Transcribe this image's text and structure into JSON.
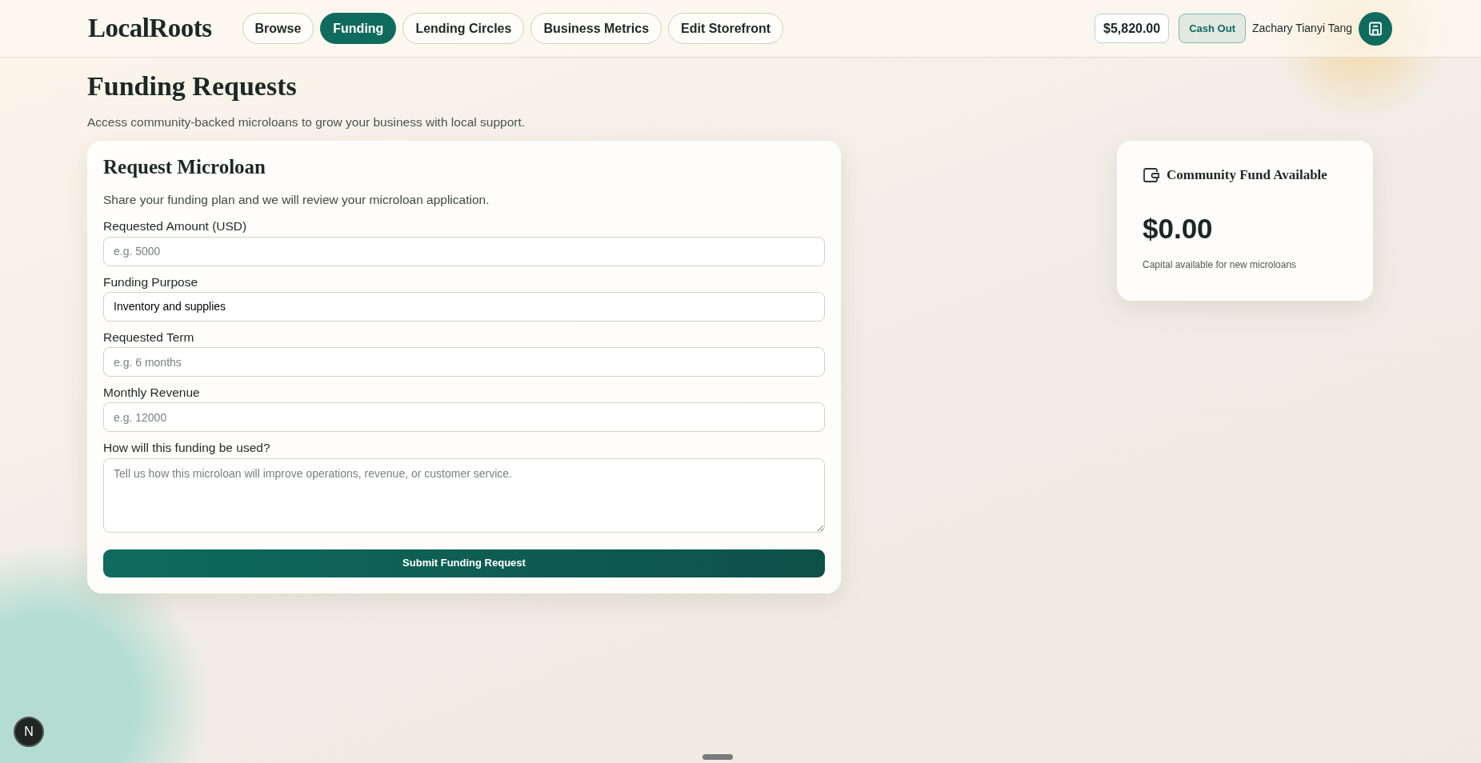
{
  "header": {
    "logo": "LocalRoots",
    "nav": [
      {
        "label": "Browse",
        "selected": false
      },
      {
        "label": "Funding",
        "selected": true
      },
      {
        "label": "Lending Circles",
        "selected": false
      },
      {
        "label": "Business Metrics",
        "selected": false
      },
      {
        "label": "Edit Storefront",
        "selected": false
      }
    ],
    "balance": "$5,820.00",
    "cash_out": "Cash Out",
    "user_name": "Zachary Tianyi Tang"
  },
  "page": {
    "title": "Funding Requests",
    "subtitle": "Access community-backed microloans to grow your business with local support."
  },
  "form": {
    "title": "Request Microloan",
    "description": "Share your funding plan and we will review your microloan application.",
    "fields": [
      {
        "kind": "input",
        "label": "Requested Amount (USD)",
        "placeholder": "e.g. 5000"
      },
      {
        "kind": "select",
        "label": "Funding Purpose",
        "value": "Inventory and supplies"
      },
      {
        "kind": "input",
        "label": "Requested Term",
        "placeholder": "e.g. 6 months"
      },
      {
        "kind": "input",
        "label": "Monthly Revenue",
        "placeholder": "e.g. 12000"
      },
      {
        "kind": "textarea",
        "label": "How will this funding be used?",
        "placeholder": "Tell us how this microloan will improve operations, revenue, or customer service."
      }
    ],
    "submit": "Submit Funding Request"
  },
  "fund_card": {
    "title": "Community Fund Available",
    "amount": "$0.00",
    "caption": "Capital available for new microloans"
  },
  "dev_badge": "N"
}
